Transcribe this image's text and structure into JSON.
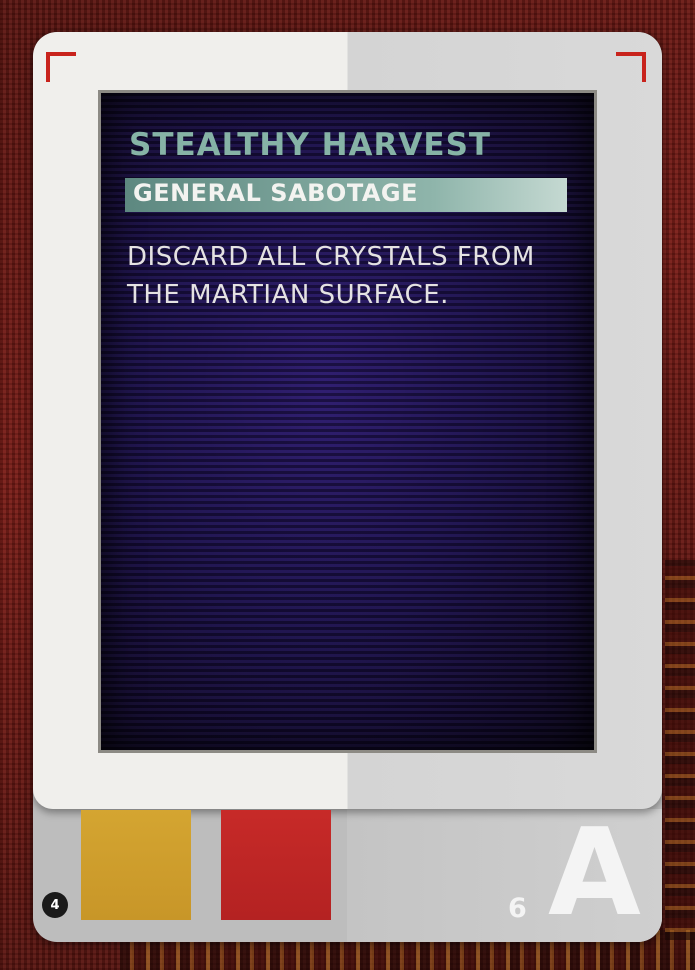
{
  "card": {
    "title": "STEALTHY HARVEST",
    "subtitle": "GENERAL SABOTAGE",
    "body": "DISCARD ALL CRYSTALS FROM THE MARTIAN SURFACE.",
    "badge_number": "4",
    "card_number": "6",
    "card_letter": "A",
    "badge_icon": "planet-icon"
  },
  "colors": {
    "corner_marks": "#c8231c",
    "title": "#86b3a6",
    "subtitle_bar": "#8fb5ab",
    "swatch_yellow": "#d4a531",
    "swatch_red": "#c72a28",
    "screen": "#1e1250"
  }
}
